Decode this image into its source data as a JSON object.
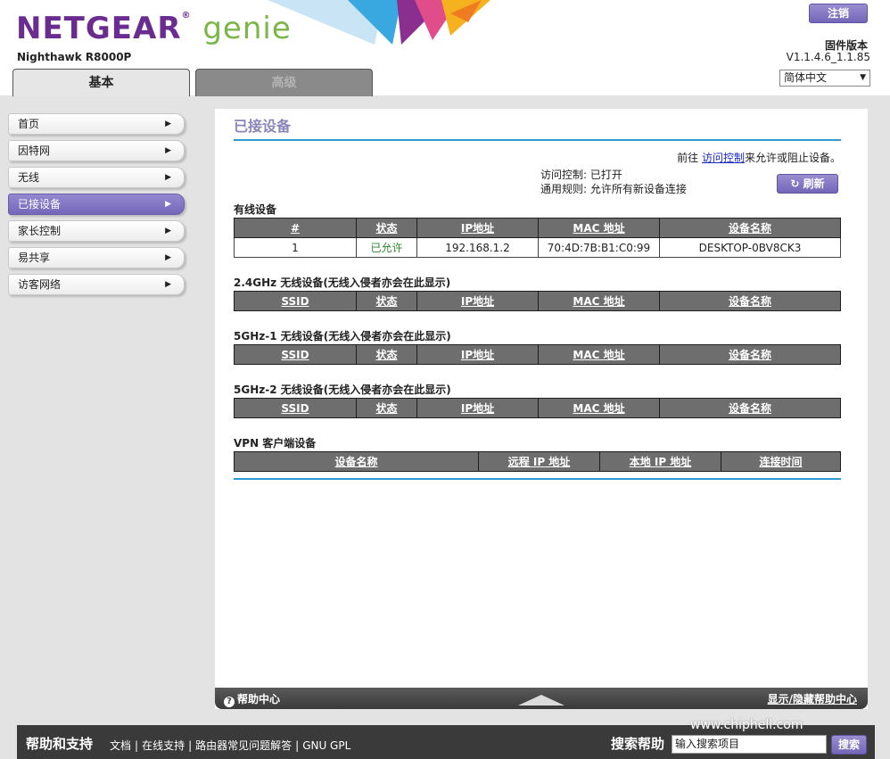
{
  "header": {
    "brand_ng": "NETGEAR",
    "brand_genie": "genie",
    "reg_mark": "®",
    "model": "Nighthawk R8000P",
    "logout_label": "注销",
    "firmware_label": "固件版本",
    "firmware_value": "V1.1.4.6_1.1.85",
    "language": "简体中文"
  },
  "tabs": [
    {
      "label": "基本",
      "active": true
    },
    {
      "label": "高级",
      "active": false
    }
  ],
  "sidebar": {
    "items": [
      {
        "label": "首页"
      },
      {
        "label": "因特网"
      },
      {
        "label": "无线"
      },
      {
        "label": "已接设备",
        "active": true
      },
      {
        "label": "家长控制"
      },
      {
        "label": "易共享"
      },
      {
        "label": "访客网络"
      }
    ]
  },
  "main": {
    "title": "已接设备",
    "access_prefix": "前往 ",
    "access_link": "访问控制",
    "access_suffix": "来允许或阻止设备。",
    "access_control": "访问控制: 已打开",
    "general_rule": "通用规则: 允许所有新设备连接",
    "refresh_label": "刷新",
    "wired": {
      "title": "有线设备",
      "headers": [
        "#",
        "状态",
        "IP地址",
        "MAC 地址",
        "设备名称"
      ],
      "rows": [
        {
          "num": "1",
          "status": "已允许",
          "ip": "192.168.1.2",
          "mac": "70:4D:7B:B1:C0:99",
          "name": "DESKTOP-0BV8CK3"
        }
      ]
    },
    "wifi24": {
      "title": "2.4GHz 无线设备(无线入侵者亦会在此显示)",
      "headers": [
        "SSID",
        "状态",
        "IP地址",
        "MAC 地址",
        "设备名称"
      ]
    },
    "wifi5_1": {
      "title": "5GHz-1 无线设备(无线入侵者亦会在此显示)",
      "headers": [
        "SSID",
        "状态",
        "IP地址",
        "MAC 地址",
        "设备名称"
      ]
    },
    "wifi5_2": {
      "title": "5GHz-2 无线设备(无线入侵者亦会在此显示)",
      "headers": [
        "SSID",
        "状态",
        "IP地址",
        "MAC 地址",
        "设备名称"
      ]
    },
    "vpn": {
      "title": "VPN 客户端设备",
      "headers": [
        "设备名称",
        "远程 IP 地址",
        "本地 IP 地址",
        "连接时间"
      ]
    },
    "help_center": "帮助中心",
    "help_toggle": "显示/隐藏帮助中心"
  },
  "footer": {
    "title": "帮助和支持",
    "links": [
      "文档",
      "在线支持",
      "路由器常见问题解答",
      "GNU GPL"
    ],
    "search_label": "搜索帮助",
    "search_value": "输入搜索项目",
    "search_button": "搜索"
  },
  "watermark": "www.chiphell.com"
}
